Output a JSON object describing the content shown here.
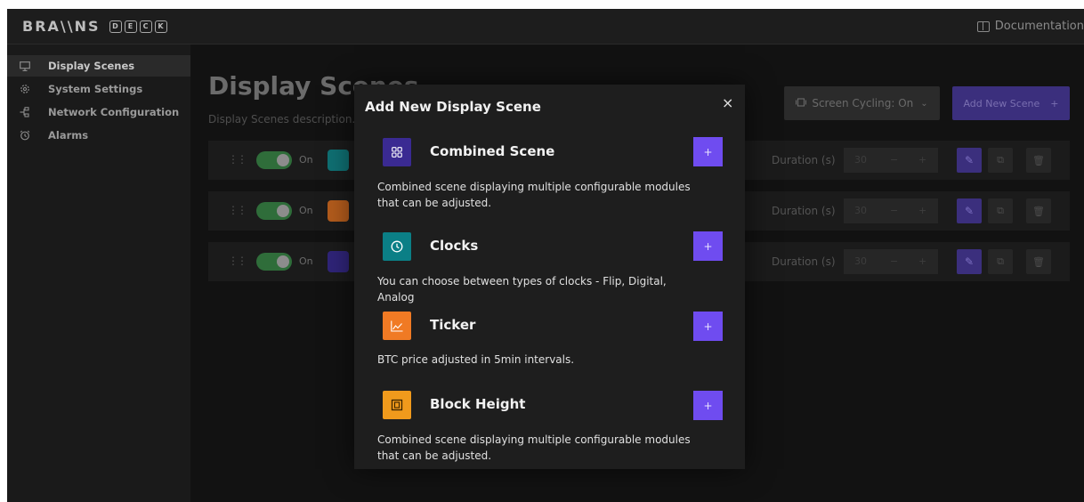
{
  "header": {
    "logo_word": "BRA\\\\NS",
    "logo_letters": [
      "D",
      "E",
      "C",
      "K"
    ],
    "documentation_label": "Documentation"
  },
  "sidebar": {
    "items": [
      {
        "label": "Display Scenes",
        "icon": "monitor-icon",
        "active": true
      },
      {
        "label": "System Settings",
        "icon": "gear-icon",
        "active": false
      },
      {
        "label": "Network Configuration",
        "icon": "network-icon",
        "active": false
      },
      {
        "label": "Alarms",
        "icon": "alarm-clock-icon",
        "active": false
      }
    ]
  },
  "main": {
    "title": "Display Scenes",
    "description": "Display Scenes description...",
    "screen_cycling_label": "Screen Cycling: On",
    "add_scene_label": "Add New Scene",
    "rows": [
      {
        "toggle_label": "On",
        "icon": "clock-icon",
        "icon_color": "#0f6f72",
        "duration_label": "Duration (s)",
        "duration_value": "30"
      },
      {
        "toggle_label": "On",
        "icon": "chart-line-icon",
        "icon_color": "#b25b1c",
        "duration_label": "Duration (s)",
        "duration_value": "30"
      },
      {
        "toggle_label": "On",
        "icon": "grid-icon",
        "icon_color": "#2f2478",
        "duration_label": "Duration (s)",
        "duration_value": "30"
      }
    ]
  },
  "modal": {
    "title": "Add New Display Scene",
    "close_symbol": "×",
    "options": [
      {
        "name": "Combined Scene",
        "icon": "grid-icon",
        "icon_color": "#3a2a92",
        "description": "Combined scene displaying multiple configurable modules that can be adjusted.",
        "add_symbol": "+"
      },
      {
        "name": "Clocks",
        "icon": "clock-icon",
        "icon_color": "#0b7f86",
        "description": "You can choose between types of clocks - Flip, Digital, Analog",
        "add_symbol": "+"
      },
      {
        "name": "Ticker",
        "icon": "chart-line-icon",
        "icon_color": "#f07a24",
        "description": "BTC price adjusted in 5min intervals.",
        "add_symbol": "+"
      },
      {
        "name": "Block Height",
        "icon": "block-icon",
        "icon_color": "#f09a1c",
        "description": "Combined scene displaying multiple configurable modules that can be adjusted.",
        "add_symbol": "+"
      }
    ]
  },
  "colors": {
    "accent": "#6f4cf0",
    "toggle_on": "#2f6d3a"
  }
}
